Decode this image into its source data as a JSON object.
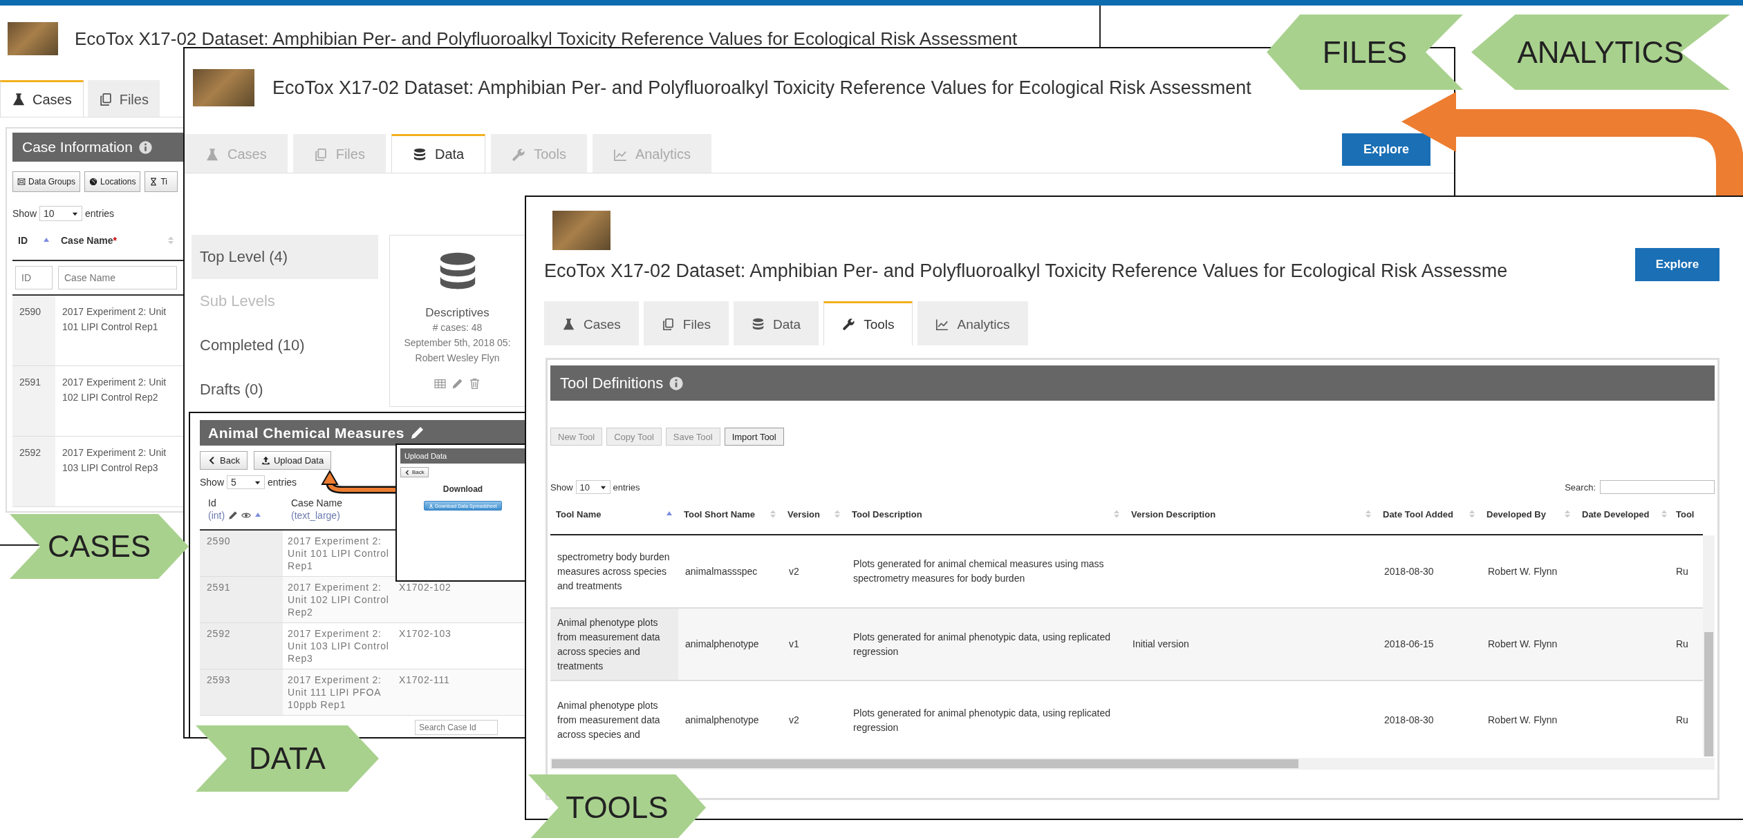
{
  "cases_window": {
    "title": "EcoTox X17-02 Dataset: Amphibian Per- and Polyfluoroalkyl Toxicity Reference Values for Ecological Risk Assessment",
    "tabs": [
      {
        "label": "Cases",
        "selected": true
      },
      {
        "label": "Files",
        "selected": false
      }
    ],
    "panel_title": "Case Information",
    "buttons": [
      "Data Groups",
      "Locations",
      "Ti"
    ],
    "show": "Show",
    "page_size": "10",
    "entries": "entries",
    "columns": [
      {
        "label": "ID",
        "sorted": true
      },
      {
        "label": "Case Name",
        "mark": "*",
        "sorted": false
      }
    ],
    "filters": [
      {
        "placeholder": "ID"
      },
      {
        "placeholder": "Case Name"
      }
    ],
    "rows": [
      {
        "id": "2590",
        "case_name": "2017 Experiment 2: Unit 101 LIPI Control Rep1"
      },
      {
        "id": "2591",
        "case_name": "2017 Experiment 2: Unit 102 LIPI Control Rep2"
      },
      {
        "id": "2592",
        "case_name": "2017 Experiment 2: Unit 103 LIPI Control Rep3"
      }
    ]
  },
  "data_window": {
    "title": "EcoTox X17-02 Dataset: Amphibian Per- and Polyfluoroalkyl Toxicity Reference Values for Ecological Risk Assessment",
    "tabs": [
      {
        "label": "Cases",
        "selected": false,
        "disabled": true
      },
      {
        "label": "Files",
        "selected": false,
        "disabled": true
      },
      {
        "label": "Data",
        "selected": true,
        "disabled": false
      },
      {
        "label": "Tools",
        "selected": false,
        "disabled": true
      },
      {
        "label": "Analytics",
        "selected": false,
        "disabled": true
      }
    ],
    "explore": "Explore",
    "levels": [
      {
        "label": "Top Level (4)",
        "selected": true,
        "disabled": false
      },
      {
        "label": "Sub Levels",
        "selected": false,
        "disabled": true
      },
      {
        "label": "Completed (10)",
        "selected": false,
        "disabled": false
      },
      {
        "label": "Drafts (0)",
        "selected": false,
        "disabled": false
      }
    ],
    "card": {
      "name": "Descriptives",
      "cases": "# cases: 48",
      "date": "September 5th, 2018 05:",
      "author": "Robert Wesley Flyn"
    },
    "measures": {
      "title": "Animal Chemical Measures",
      "buttons": [
        "Back",
        "Upload Data"
      ],
      "show": "Show",
      "page_size": "5",
      "entries": "entries",
      "columns": [
        {
          "label": "Id",
          "type": "(int)"
        },
        {
          "label": "Case Name",
          "type": "(text_large)"
        }
      ],
      "rows": [
        {
          "id": "2590",
          "case_name": "2017 Experiment 2: Unit 101 LIPI Control Rep1"
        },
        {
          "id": "2591",
          "case_name": "2017 Experiment 2: Unit 102 LIPI Control Rep2",
          "code": "X1702-102"
        },
        {
          "id": "2592",
          "case_name": "2017 Experiment 2: Unit 103 LIPI Control Rep3",
          "code": "X1702-103"
        },
        {
          "id": "2593",
          "case_name": "2017 Experiment 2: Unit 111 LIPI PFOA 10ppb Rep1",
          "code": "X1702-111"
        }
      ],
      "search_placeholder": "Search Case Id",
      "dialog": {
        "title": "Upload Data",
        "back": "Back",
        "heading": "Download",
        "button": "Download Data Spreadsheet"
      }
    }
  },
  "tools_window": {
    "title": "EcoTox X17-02 Dataset: Amphibian Per- and Polyfluoroalkyl Toxicity Reference Values for Ecological Risk Assessme",
    "explore": "Explore",
    "tabs": [
      {
        "label": "Cases",
        "selected": false
      },
      {
        "label": "Files",
        "selected": false
      },
      {
        "label": "Data",
        "selected": false
      },
      {
        "label": "Tools",
        "selected": true
      },
      {
        "label": "Analytics",
        "selected": false
      }
    ],
    "panel_title": "Tool Definitions",
    "buttons": [
      {
        "label": "New Tool",
        "disabled": true
      },
      {
        "label": "Copy Tool",
        "disabled": true
      },
      {
        "label": "Save Tool",
        "disabled": true
      },
      {
        "label": "Import Tool",
        "disabled": false
      }
    ],
    "show": "Show",
    "page_size": "10",
    "entries": "entries",
    "search_label": "Search:",
    "columns": [
      {
        "label": "Tool Name",
        "sorted": true
      },
      {
        "label": "Tool Short Name",
        "sorted": false
      },
      {
        "label": "Version",
        "sorted": false
      },
      {
        "label": "Tool Description",
        "sorted": false
      },
      {
        "label": "Version Description",
        "sorted": false
      },
      {
        "label": "Date Tool Added",
        "sorted": false
      },
      {
        "label": "Developed By",
        "sorted": false
      },
      {
        "label": "Date Developed",
        "sorted": false
      },
      {
        "label": "Tool"
      }
    ],
    "rows": [
      [
        "spectrometry body burden measures across species and treatments",
        "animalmassspec",
        "v2",
        "Plots generated for animal chemical measures using mass spectrometry measures for body burden",
        "",
        "2018-08-30",
        "Robert W. Flynn",
        "",
        "Ru"
      ],
      [
        "Animal phenotype plots from measurement data across species and treatments",
        "animalphenotype",
        "v1",
        "Plots generated for animal phenotypic data, using replicated regression",
        "Initial version",
        "2018-06-15",
        "Robert W. Flynn",
        "",
        "Ru"
      ],
      [
        "Animal phenotype plots from measurement data across species and",
        "animalphenotype",
        "v2",
        "Plots generated for animal phenotypic data, using replicated regression",
        "",
        "2018-08-30",
        "Robert W. Flynn",
        "",
        "Ru"
      ]
    ]
  },
  "callouts": [
    {
      "label": "FILES"
    },
    {
      "label": "ANALYTICS"
    },
    {
      "label": "CASES"
    },
    {
      "label": "DATA"
    },
    {
      "label": "TOOLS"
    }
  ]
}
